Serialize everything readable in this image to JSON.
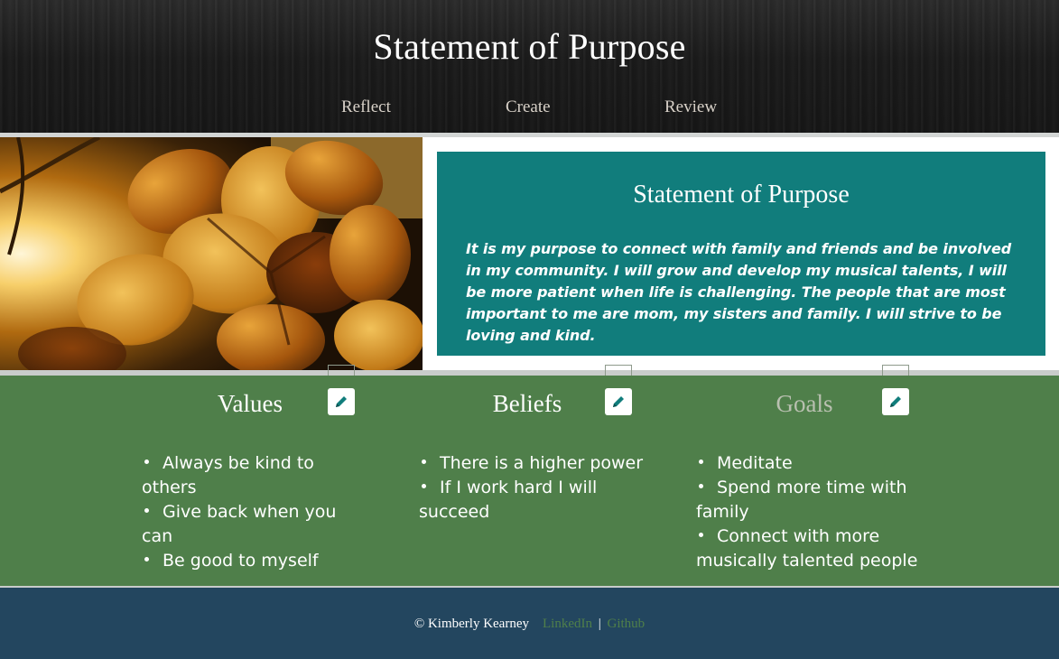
{
  "header": {
    "title": "Statement of Purpose",
    "nav": [
      {
        "label": "Reflect"
      },
      {
        "label": "Create"
      },
      {
        "label": "Review"
      }
    ]
  },
  "hero": {
    "image_alt": "backlit autumn leaves",
    "card_title": "Statement of Purpose",
    "card_text": "It is my purpose to connect with family and friends and be involved in my community. I will grow and develop my musical talents, I will be more patient when life is challenging. The people that are most important to me are mom, my sisters and family. I will strive to be loving and kind."
  },
  "columns": [
    {
      "title": "Values",
      "edit_icon": "pencil-icon",
      "items": [
        "Always be kind to others",
        "Give back when you can",
        "Be good to myself"
      ]
    },
    {
      "title": "Beliefs",
      "edit_icon": "pencil-icon",
      "items": [
        "There is a higher power",
        "If I work hard I will succeed"
      ]
    },
    {
      "title": "Goals",
      "edit_icon": "pencil-icon",
      "items": [
        "Meditate",
        "Spend more time with family",
        "Connect with more musically talented people"
      ]
    }
  ],
  "footer": {
    "copyright": "© Kimberly Kearney",
    "linkedin": "LinkedIn",
    "separator": "|",
    "github": "Github"
  },
  "colors": {
    "header_bg": "#1a1a1a",
    "card_teal": "#117d7c",
    "columns_green": "#4f7f4a",
    "footer_navy": "#23465f",
    "link_green": "#4f7f4a"
  }
}
